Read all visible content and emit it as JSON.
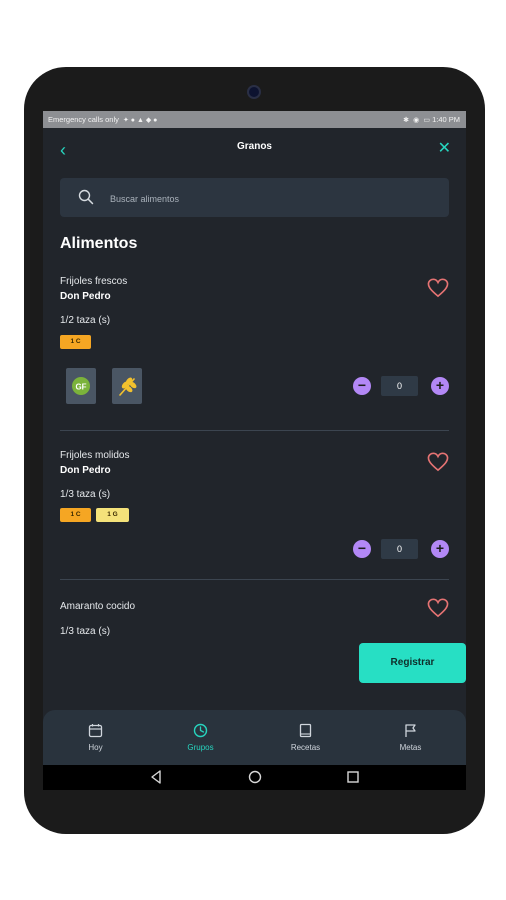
{
  "status_bar": {
    "left": "Emergency calls only",
    "time": "1:40 PM"
  },
  "header": {
    "title": "Granos"
  },
  "search": {
    "placeholder": "Buscar alimentos"
  },
  "section": {
    "title": "Alimentos"
  },
  "foods": [
    {
      "name": "Frijoles frescos",
      "brand": "Don Pedro",
      "portion": "1/2 taza (s)",
      "chips": [
        "1 C"
      ],
      "badges": [
        "gf-badge",
        "wheat-icon"
      ],
      "quantity": "0"
    },
    {
      "name": "Frijoles molidos",
      "brand": "Don Pedro",
      "portion": "1/3 taza (s)",
      "chips": [
        "1 C",
        "1 G"
      ],
      "quantity": "0"
    },
    {
      "name": "Amaranto cocido",
      "portion": "1/3 taza (s)"
    }
  ],
  "register_button": "Registrar",
  "tabs": [
    {
      "label": "Hoy",
      "icon": "calendar-icon",
      "active": false
    },
    {
      "label": "Grupos",
      "icon": "groups-icon",
      "active": true
    },
    {
      "label": "Recetas",
      "icon": "book-icon",
      "active": false
    },
    {
      "label": "Metas",
      "icon": "flag-icon",
      "active": false
    }
  ],
  "colors": {
    "accent": "#27d5bf",
    "background": "#21252b",
    "chip_c": "#f5a623",
    "chip_g": "#f4e27a",
    "stepper": "#b388f6",
    "heart": "#e57373"
  }
}
